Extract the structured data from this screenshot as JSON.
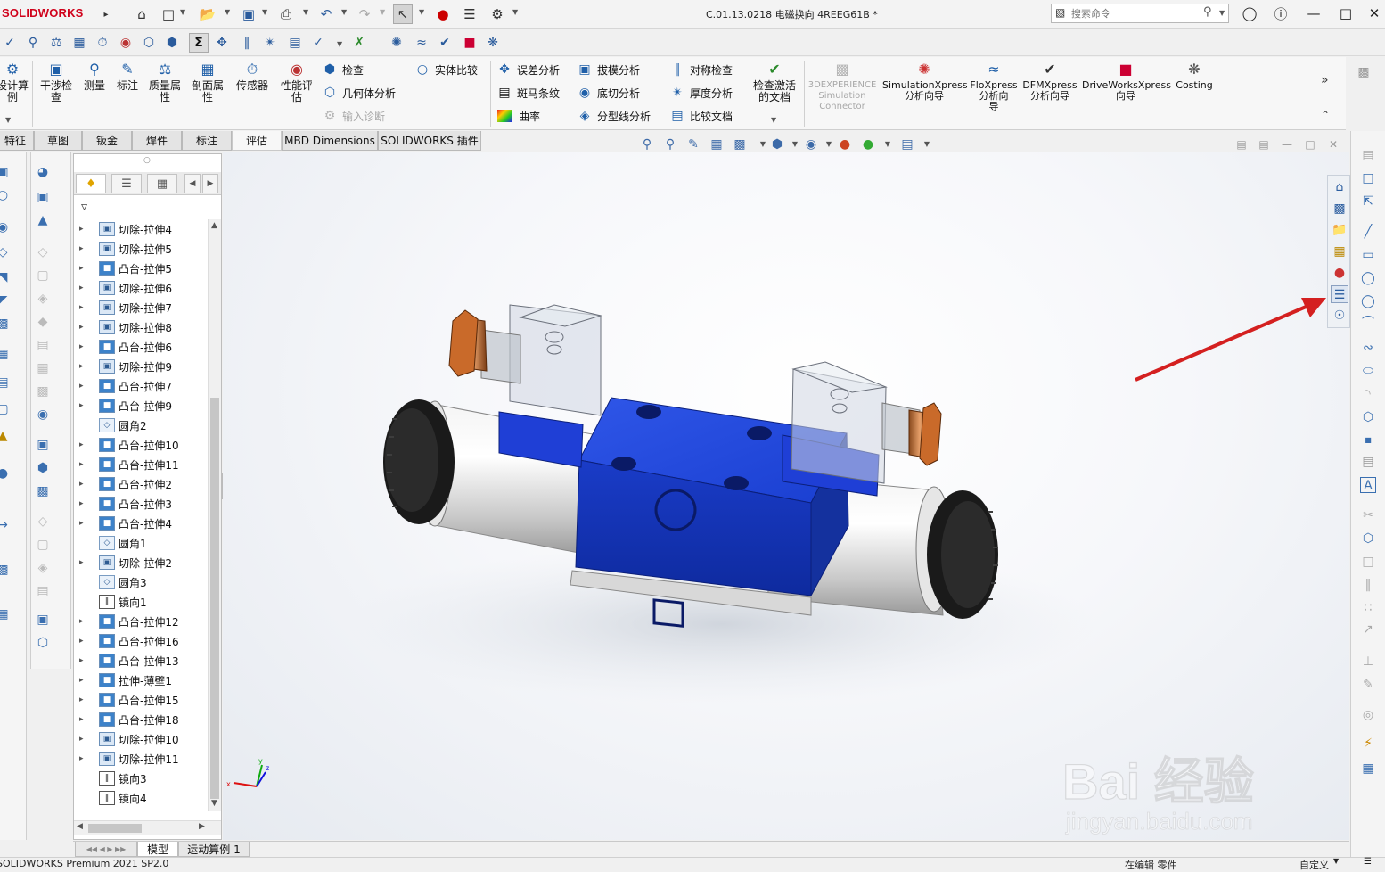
{
  "app": {
    "logo": "SOLIDWORKS",
    "title": "C.01.13.0218 电磁换向 4REEG61B *",
    "search_placeholder": "搜索命令"
  },
  "ribbon": {
    "big_buttons": [
      {
        "label": "设计算\n例",
        "icon": "design-study-icon"
      },
      {
        "label": "干涉检\n查",
        "icon": "interference-icon"
      },
      {
        "label": "测量",
        "icon": "measure-icon"
      },
      {
        "label": "标注",
        "icon": "markup-icon"
      },
      {
        "label": "质量属\n性",
        "icon": "mass-properties-icon"
      },
      {
        "label": "剖面属\n性",
        "icon": "section-properties-icon"
      },
      {
        "label": "传感器",
        "icon": "sensor-icon"
      },
      {
        "label": "性能评\n估",
        "icon": "performance-icon"
      }
    ],
    "small_col1": [
      {
        "label": "检查",
        "icon": "check-icon",
        "disabled": false
      },
      {
        "label": "几何体分析",
        "icon": "geometry-analysis-icon",
        "disabled": false
      },
      {
        "label": "输入诊断",
        "icon": "import-diagnostics-icon",
        "disabled": true
      }
    ],
    "small_col2": [
      {
        "label": "实体比较",
        "icon": "compare-bodies-icon",
        "disabled": false
      }
    ],
    "small_col3": [
      {
        "label": "误差分析",
        "icon": "deviation-analysis-icon",
        "disabled": false
      },
      {
        "label": "斑马条纹",
        "icon": "zebra-stripes-icon",
        "disabled": false
      },
      {
        "label": "曲率",
        "icon": "curvature-icon",
        "disabled": false
      }
    ],
    "small_col4": [
      {
        "label": "拔模分析",
        "icon": "draft-analysis-icon",
        "disabled": false
      },
      {
        "label": "底切分析",
        "icon": "undercut-analysis-icon",
        "disabled": false
      },
      {
        "label": "分型线分析",
        "icon": "parting-line-icon",
        "disabled": false
      }
    ],
    "small_col5": [
      {
        "label": "对称检查",
        "icon": "symmetry-check-icon",
        "disabled": false
      },
      {
        "label": "厚度分析",
        "icon": "thickness-analysis-icon",
        "disabled": false
      },
      {
        "label": "比较文档",
        "icon": "compare-docs-icon",
        "disabled": false
      }
    ],
    "check_active": "检查激活\n的文档",
    "addins": [
      {
        "label": "3DEXPERIENCE\nSimulation\nConnector",
        "disabled": true
      },
      {
        "label": "SimulationXpress\n分析向导",
        "disabled": false
      },
      {
        "label": "FloXpress\n分析向\n导",
        "disabled": false
      },
      {
        "label": "DFMXpress\n分析向导",
        "disabled": false
      },
      {
        "label": "DriveWorksXpress\n向导",
        "disabled": false
      },
      {
        "label": "Costing",
        "disabled": false
      }
    ]
  },
  "tabs": [
    "特征",
    "草图",
    "钣金",
    "焊件",
    "标注",
    "评估",
    "MBD Dimensions",
    "SOLIDWORKS 插件"
  ],
  "active_tab": "评估",
  "feature_tree": [
    {
      "label": "切除-拉伸4",
      "type": "cut",
      "expandable": true
    },
    {
      "label": "切除-拉伸5",
      "type": "cut",
      "expandable": true
    },
    {
      "label": "凸台-拉伸5",
      "type": "boss",
      "expandable": true
    },
    {
      "label": "切除-拉伸6",
      "type": "cut",
      "expandable": true
    },
    {
      "label": "切除-拉伸7",
      "type": "cut",
      "expandable": true
    },
    {
      "label": "切除-拉伸8",
      "type": "cut",
      "expandable": true
    },
    {
      "label": "凸台-拉伸6",
      "type": "boss",
      "expandable": true
    },
    {
      "label": "切除-拉伸9",
      "type": "cut",
      "expandable": true
    },
    {
      "label": "凸台-拉伸7",
      "type": "boss",
      "expandable": true
    },
    {
      "label": "凸台-拉伸9",
      "type": "boss",
      "expandable": true
    },
    {
      "label": "圆角2",
      "type": "fillet",
      "expandable": false
    },
    {
      "label": "凸台-拉伸10",
      "type": "boss",
      "expandable": true
    },
    {
      "label": "凸台-拉伸11",
      "type": "boss",
      "expandable": true
    },
    {
      "label": "凸台-拉伸2",
      "type": "boss",
      "expandable": true
    },
    {
      "label": "凸台-拉伸3",
      "type": "boss",
      "expandable": true
    },
    {
      "label": "凸台-拉伸4",
      "type": "boss",
      "expandable": true
    },
    {
      "label": "圆角1",
      "type": "fillet",
      "expandable": false
    },
    {
      "label": "切除-拉伸2",
      "type": "cut",
      "expandable": true
    },
    {
      "label": "圆角3",
      "type": "fillet",
      "expandable": false
    },
    {
      "label": "镜向1",
      "type": "mirror",
      "expandable": false
    },
    {
      "label": "凸台-拉伸12",
      "type": "boss",
      "expandable": true
    },
    {
      "label": "凸台-拉伸16",
      "type": "boss",
      "expandable": true
    },
    {
      "label": "凸台-拉伸13",
      "type": "boss",
      "expandable": true
    },
    {
      "label": "拉伸-薄壁1",
      "type": "boss",
      "expandable": true
    },
    {
      "label": "凸台-拉伸15",
      "type": "boss",
      "expandable": true
    },
    {
      "label": "凸台-拉伸18",
      "type": "boss",
      "expandable": true
    },
    {
      "label": "切除-拉伸10",
      "type": "cut",
      "expandable": true
    },
    {
      "label": "切除-拉伸11",
      "type": "cut",
      "expandable": true
    },
    {
      "label": "镜向3",
      "type": "mirror",
      "expandable": false
    },
    {
      "label": "镜向4",
      "type": "mirror",
      "expandable": false
    }
  ],
  "bottom_tabs": [
    "模型",
    "运动算例 1"
  ],
  "status": {
    "left": "SOLIDWORKS Premium 2021 SP2.0",
    "mode": "在编辑 零件",
    "custom": "自定义"
  },
  "watermark": {
    "line1": "Bai  经验",
    "line2": "jingyan.baidu.com"
  },
  "colors": {
    "accent": "#1f5fa8",
    "brand_red": "#d0021b",
    "valve_blue": "#1a3fd1",
    "arrow_red": "#d42020"
  }
}
